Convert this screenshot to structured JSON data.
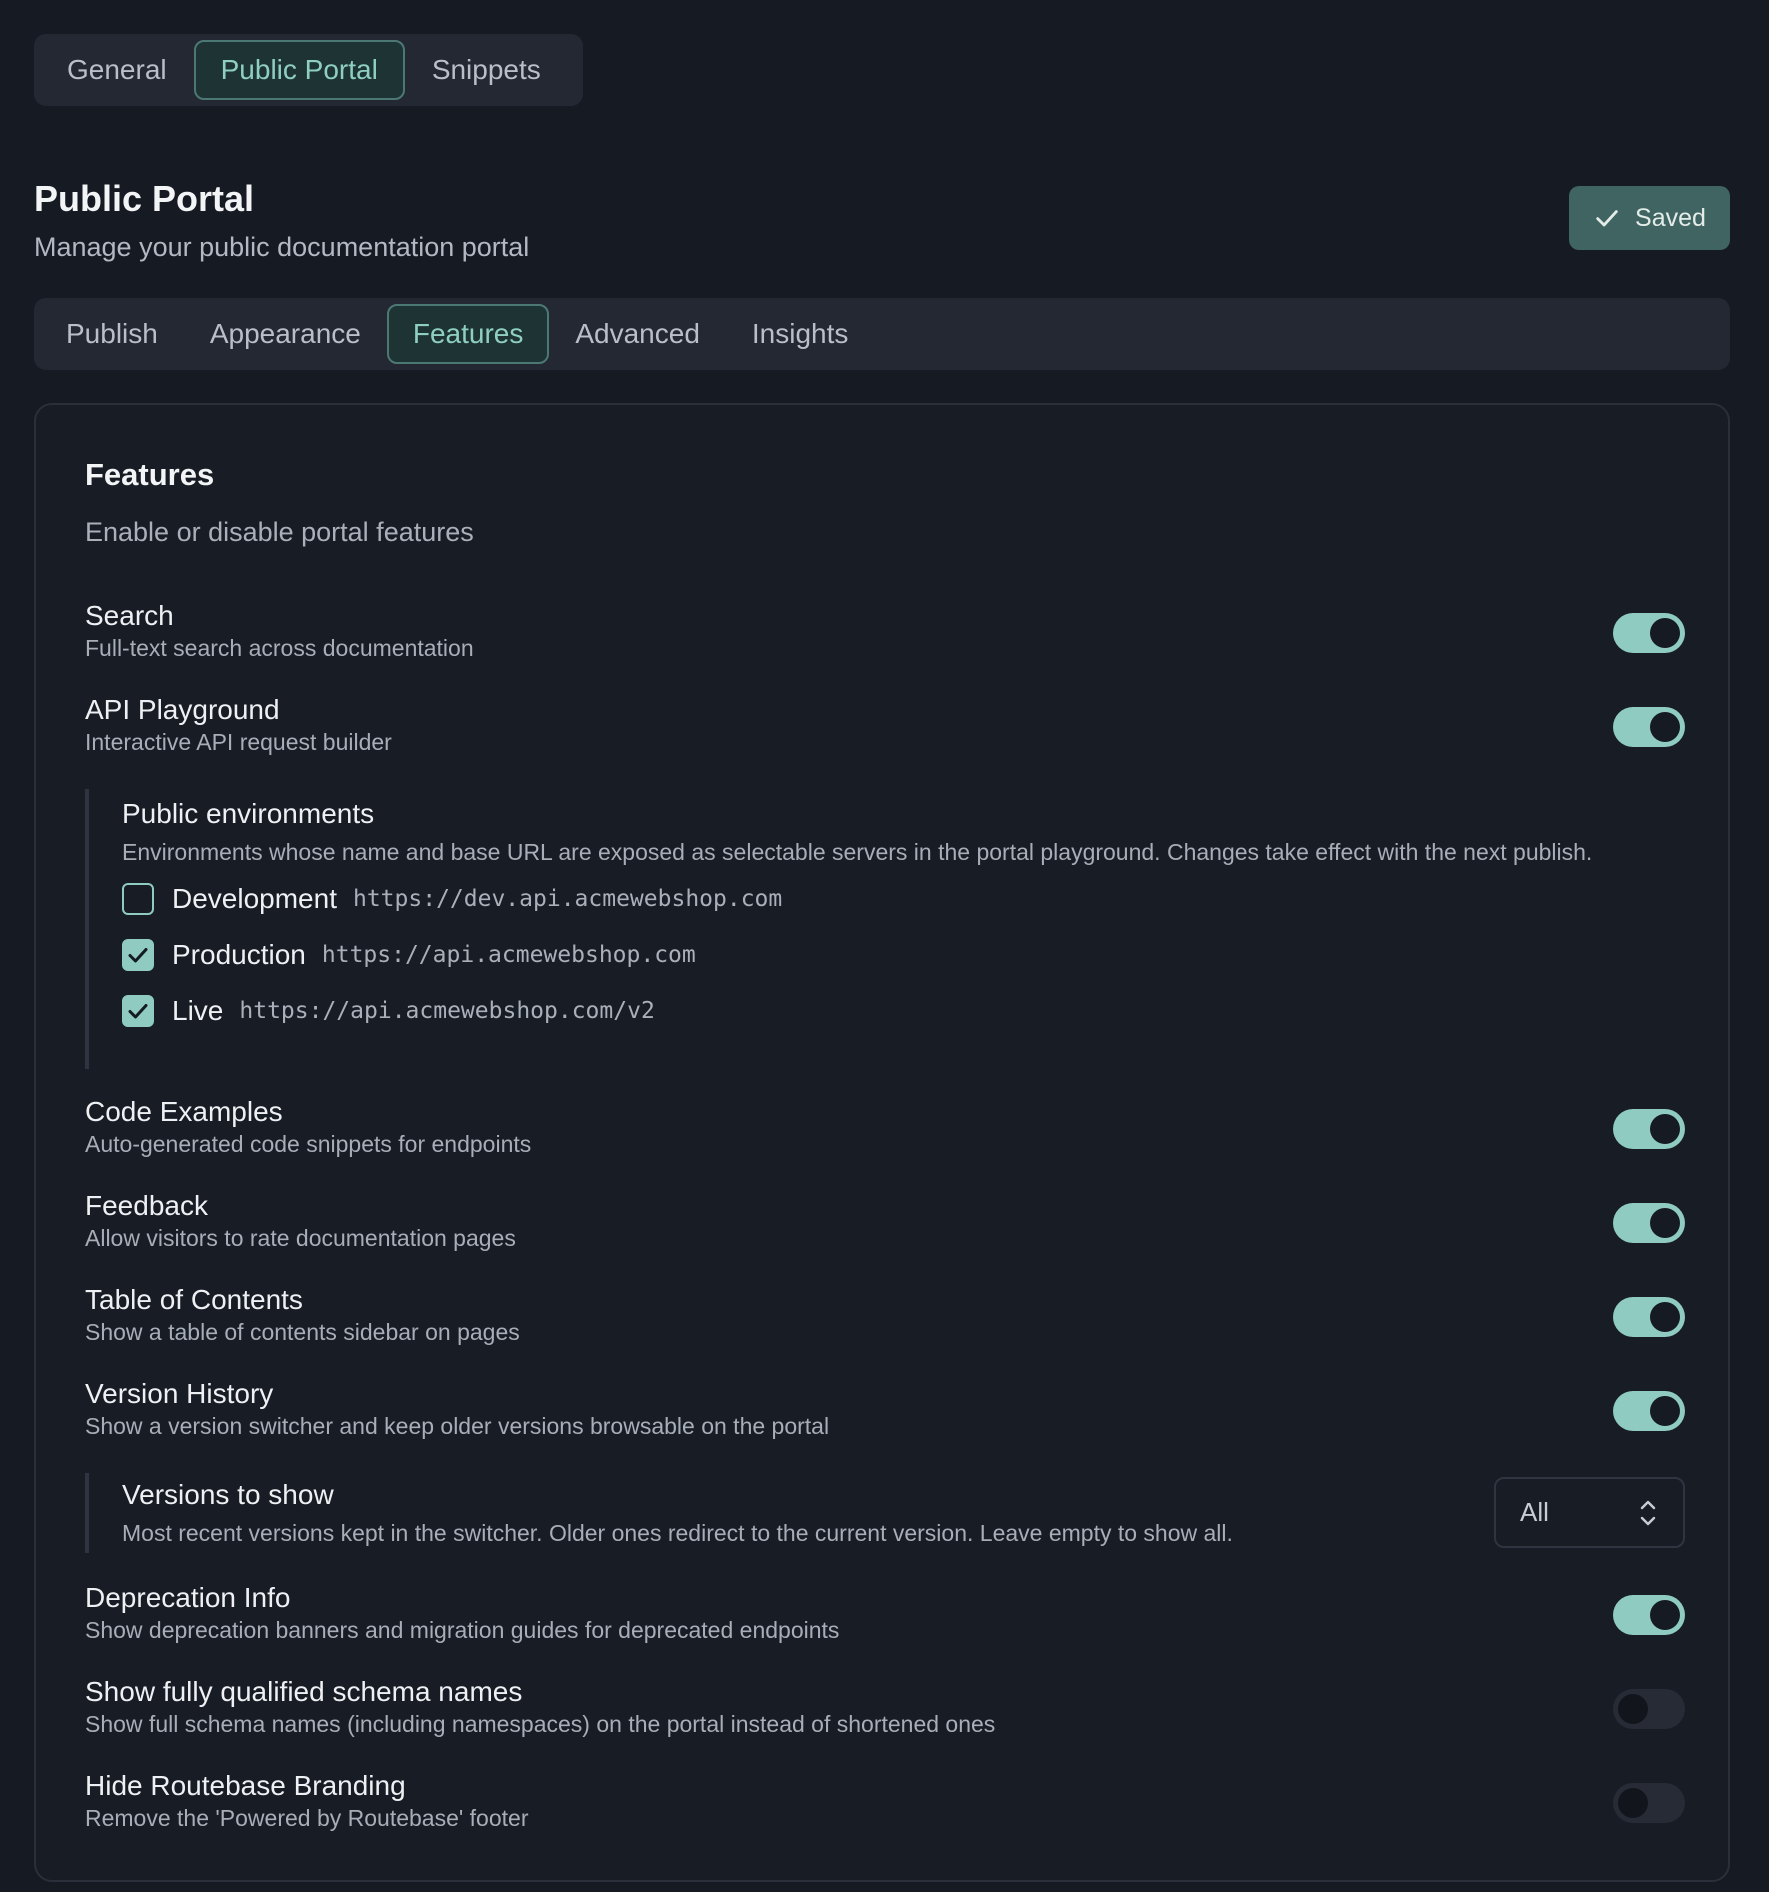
{
  "top_tabs": [
    "General",
    "Public Portal",
    "Snippets"
  ],
  "page": {
    "title": "Public Portal",
    "subtitle": "Manage your public documentation portal",
    "saved_label": "Saved"
  },
  "sub_tabs": [
    "Publish",
    "Appearance",
    "Features",
    "Advanced",
    "Insights"
  ],
  "card": {
    "title": "Features",
    "subtitle": "Enable or disable portal features"
  },
  "features": {
    "search": {
      "label": "Search",
      "desc": "Full-text search across documentation",
      "enabled": true
    },
    "api_playground": {
      "label": "API Playground",
      "desc": "Interactive API request builder",
      "enabled": true
    },
    "code_examples": {
      "label": "Code Examples",
      "desc": "Auto-generated code snippets for endpoints",
      "enabled": true
    },
    "feedback": {
      "label": "Feedback",
      "desc": "Allow visitors to rate documentation pages",
      "enabled": true
    },
    "toc": {
      "label": "Table of Contents",
      "desc": "Show a table of contents sidebar on pages",
      "enabled": true
    },
    "version_history": {
      "label": "Version History",
      "desc": "Show a version switcher and keep older versions browsable on the portal",
      "enabled": true
    },
    "deprecation": {
      "label": "Deprecation Info",
      "desc": "Show deprecation banners and migration guides for deprecated endpoints",
      "enabled": true
    },
    "fq_schema": {
      "label": "Show fully qualified schema names",
      "desc": "Show full schema names (including namespaces) on the portal instead of shortened ones",
      "enabled": false
    },
    "hide_branding": {
      "label": "Hide Routebase Branding",
      "desc": "Remove the 'Powered by Routebase' footer",
      "enabled": false
    }
  },
  "public_envs": {
    "title": "Public environments",
    "desc": "Environments whose name and base URL are exposed as selectable servers in the portal playground. Changes take effect with the next publish.",
    "items": [
      {
        "name": "Development",
        "url": "https://dev.api.acmewebshop.com",
        "checked": false
      },
      {
        "name": "Production",
        "url": "https://api.acmewebshop.com",
        "checked": true
      },
      {
        "name": "Live",
        "url": "https://api.acmewebshop.com/v2",
        "checked": true
      }
    ]
  },
  "versions_to_show": {
    "title": "Versions to show",
    "desc": "Most recent versions kept in the switcher. Older ones redirect to the current version. Leave empty to show all.",
    "value": "All"
  },
  "colors": {
    "accent": "#8fcbc0",
    "background": "#161a23",
    "panel": "#232833"
  }
}
